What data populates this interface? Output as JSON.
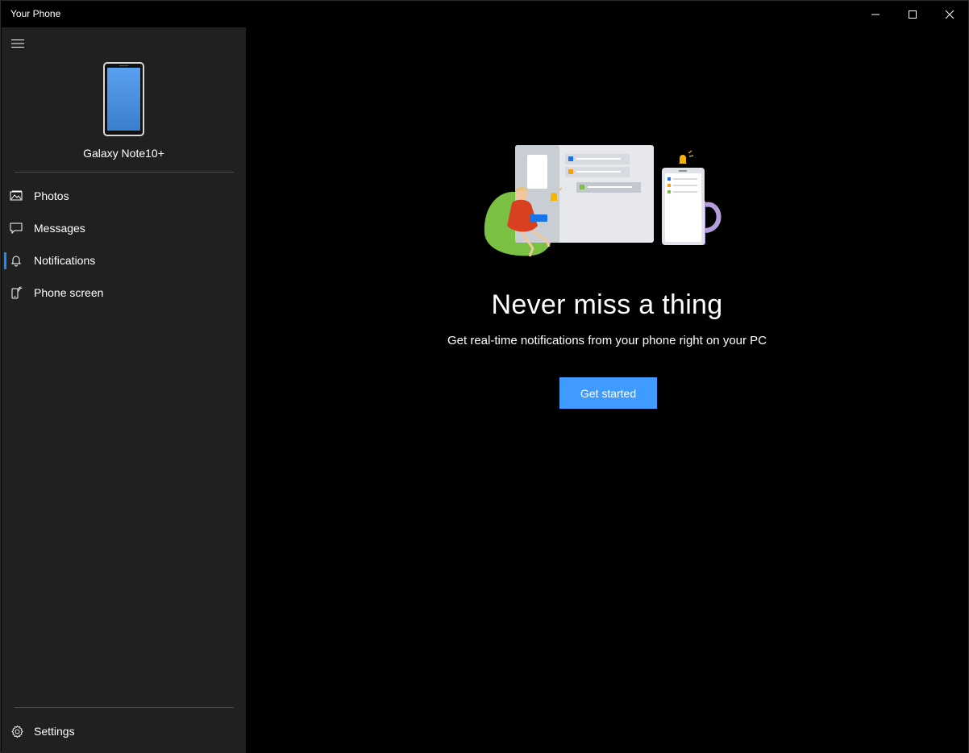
{
  "window": {
    "title": "Your Phone",
    "controls": [
      "minimize-icon",
      "maximize-icon",
      "close-icon"
    ]
  },
  "sidebar": {
    "menu_icon": "hamburger-icon",
    "device": {
      "name": "Galaxy Note10+",
      "screen_color": "#4a8fe2"
    },
    "items": [
      {
        "label": "Photos",
        "icon": "photos-icon",
        "active": false
      },
      {
        "label": "Messages",
        "icon": "messages-icon",
        "active": false
      },
      {
        "label": "Notifications",
        "icon": "bell-icon",
        "active": true
      },
      {
        "label": "Phone screen",
        "icon": "phone-screen-icon",
        "active": false
      }
    ],
    "settings": {
      "label": "Settings",
      "icon": "gear-icon"
    },
    "accent_color": "#1a8cff"
  },
  "main": {
    "illustration": "notifications-illustration",
    "headline": "Never miss a thing",
    "subtext": "Get real-time notifications from your phone right on your PC",
    "cta_label": "Get started",
    "cta_color": "#3f9bff"
  }
}
